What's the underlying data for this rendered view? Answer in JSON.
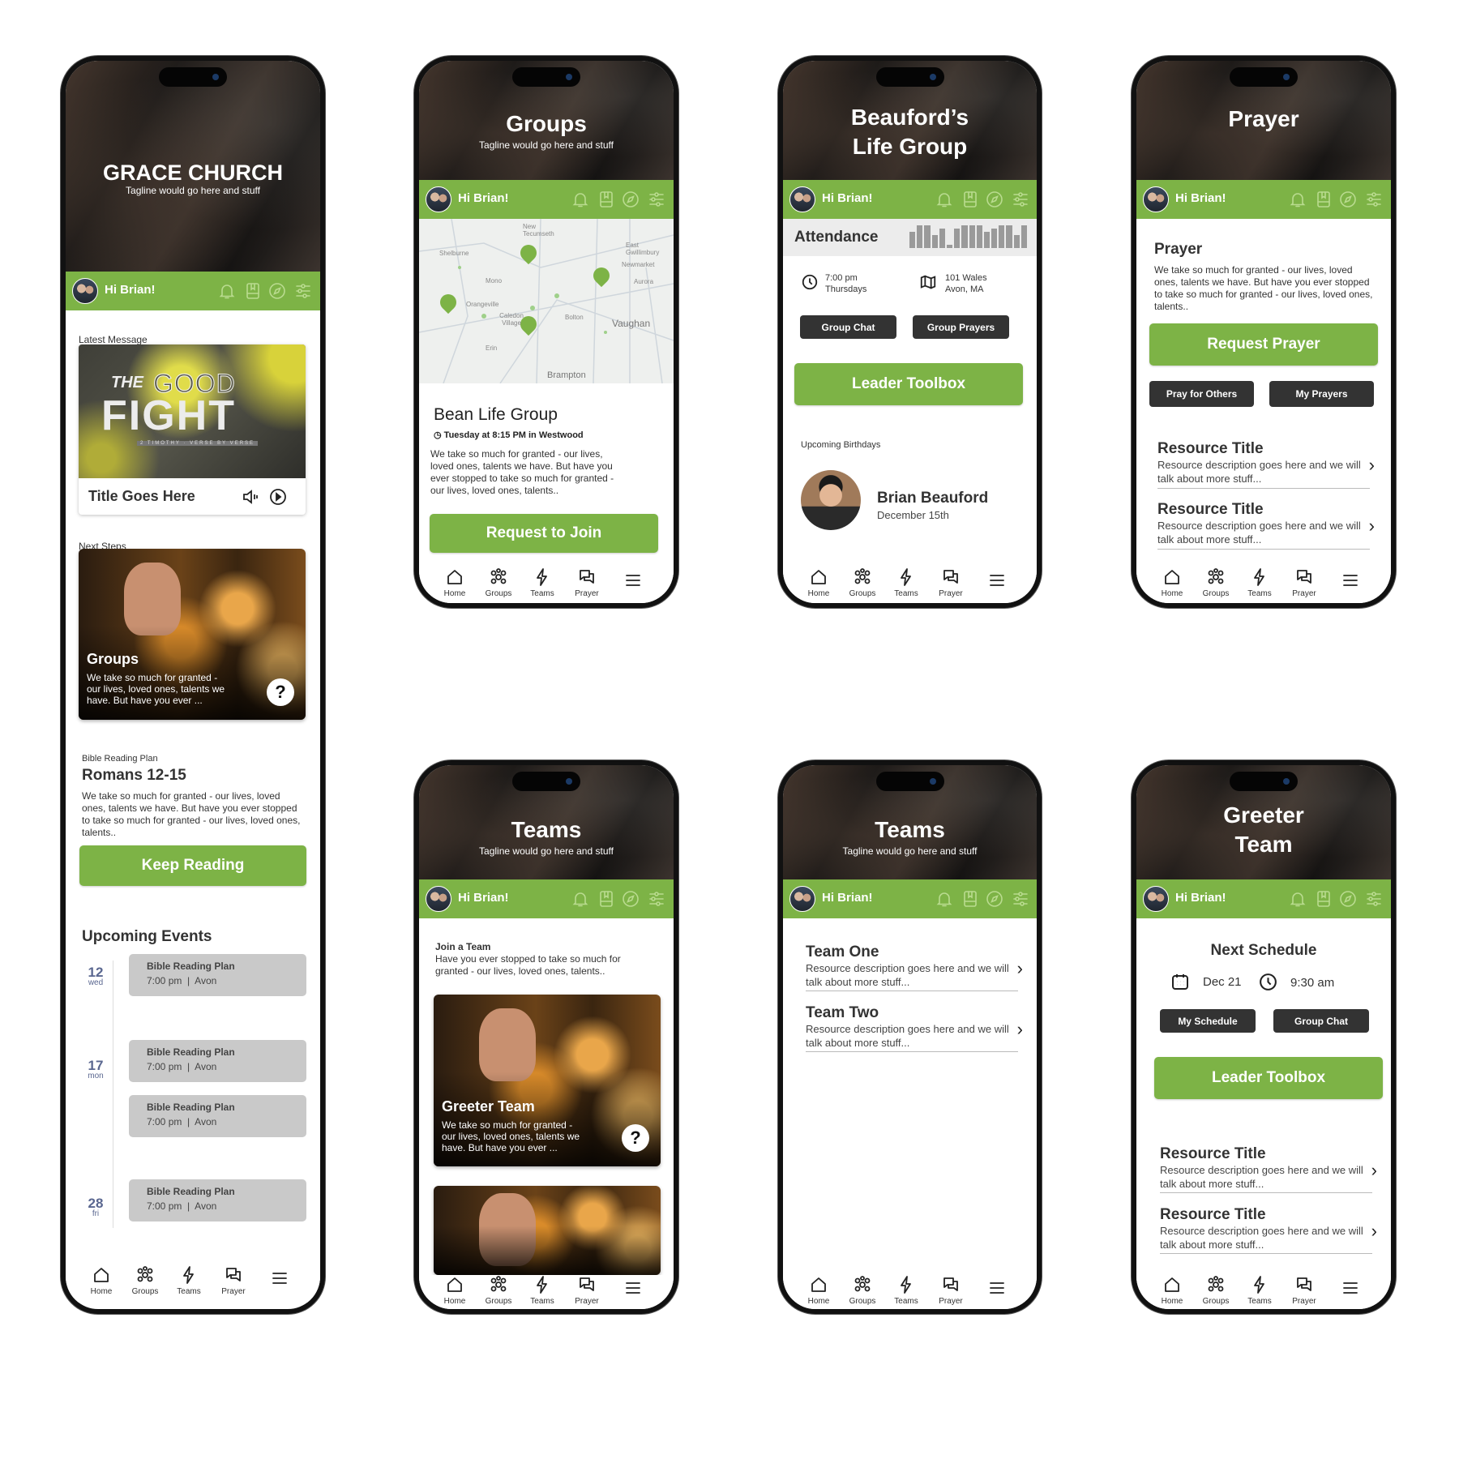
{
  "common": {
    "greeting": "Hi Brian!",
    "nav": [
      "Home",
      "Groups",
      "Teams",
      "Prayer"
    ],
    "icons": [
      "bell-icon",
      "book-icon",
      "compass-icon",
      "sliders-icon"
    ],
    "accent": "#7db346",
    "dark_button": "#333333"
  },
  "home": {
    "hero_title": "GRACE CHURCH",
    "tagline": "Tagline would go here and stuff",
    "latest_label": "Latest Message",
    "message": {
      "art_the": "THE",
      "art_good": "GOOD",
      "art_fight": "FIGHT",
      "art_sub": "2 TIMOTHY · VERSE BY VERSE",
      "title": "Title Goes Here"
    },
    "next_steps_label": "Next Steps",
    "next_card": {
      "title": "Groups",
      "text": "We take so much for granted - our lives, loved ones, talents we have. But have you ever ..."
    },
    "plan_label": "Bible Reading Plan",
    "plan_title": "Romans 12-15",
    "plan_text": "We take so much for granted - our lives, loved ones, talents we have. But have you ever stopped to take so much for granted - our lives, loved ones, talents..",
    "plan_button": "Keep Reading",
    "events_title": "Upcoming Events",
    "dates": [
      {
        "day": "12",
        "dow": "wed"
      },
      {
        "day": "17",
        "dow": "mon"
      },
      {
        "day": "28",
        "dow": "fri"
      }
    ],
    "events": [
      {
        "title": "Bible Reading Plan",
        "time": "7:00 pm",
        "place": "Avon"
      },
      {
        "title": "Bible Reading Plan",
        "time": "7:00 pm",
        "place": "Avon"
      },
      {
        "title": "Bible Reading Plan",
        "time": "7:00 pm",
        "place": "Avon"
      },
      {
        "title": "Bible Reading Plan",
        "time": "7:00 pm",
        "place": "Avon"
      }
    ]
  },
  "groups": {
    "hero_title": "Groups",
    "tagline": "Tagline would go here and stuff",
    "map_labels": [
      "New Tecumseth",
      "Shelburne",
      "Mono",
      "Orangeville",
      "Caledon Village",
      "Bolton",
      "Vaughan",
      "Erin",
      "Brampton",
      "East Gwillimbury",
      "Newmarket",
      "Aurora"
    ],
    "group_name": "Bean Life Group",
    "schedule": "Tuesday at 8:15 PM in Westwood",
    "description": "We take so much for granted - our lives, loved ones, talents we have. But have you ever stopped to take so much for granted - our lives, loved ones, talents..",
    "join_button": "Request to Join"
  },
  "life_group": {
    "hero_line1": "Beauford’s",
    "hero_line2": "Life Group",
    "attendance_label": "Attendance",
    "attendance_bars": [
      5,
      7,
      7,
      4,
      6,
      1,
      6,
      7,
      7,
      7,
      5,
      6,
      7,
      7,
      4,
      7
    ],
    "time": "7:00 pm",
    "day": "Thursdays",
    "address1": "101 Wales",
    "address2": "Avon, MA",
    "chat_button": "Group Chat",
    "prayers_button": "Group Prayers",
    "toolbox_button": "Leader Toolbox",
    "birthdays_label": "Upcoming Birthdays",
    "birthday_name": "Brian Beauford",
    "birthday_date": "December 15th"
  },
  "prayer": {
    "hero_title": "Prayer",
    "heading": "Prayer",
    "text": "We take so much for granted - our lives, loved ones, talents we have. But have you ever stopped to take so much for granted - our lives, loved ones, talents..",
    "request_button": "Request Prayer",
    "others_button": "Pray for Others",
    "mine_button": "My Prayers",
    "resources": [
      {
        "title": "Resource Title",
        "desc": "Resource description goes here and we will talk about more stuff..."
      },
      {
        "title": "Resource Title",
        "desc": "Resource description goes here and we will talk about more stuff..."
      }
    ]
  },
  "teams": {
    "hero_title": "Teams",
    "tagline": "Tagline would go here and stuff",
    "join_title": "Join a Team",
    "join_text": "Have you ever stopped to take so much for granted - our lives, loved ones, talents..",
    "card": {
      "title": "Greeter Team",
      "text": "We take so much for granted - our lives, loved ones, talents we have. But have you ever ..."
    }
  },
  "teams_list": {
    "hero_title": "Teams",
    "tagline": "Tagline would go here and stuff",
    "items": [
      {
        "title": "Team One",
        "desc": "Resource description goes here and we will talk about more stuff..."
      },
      {
        "title": "Team Two",
        "desc": "Resource description goes here and we will talk about more stuff..."
      }
    ]
  },
  "greeter": {
    "hero_line1": "Greeter",
    "hero_line2": "Team",
    "schedule_title": "Next Schedule",
    "date": "Dec 21",
    "time": "9:30 am",
    "schedule_button": "My Schedule",
    "chat_button": "Group Chat",
    "toolbox_button": "Leader Toolbox",
    "resources": [
      {
        "title": "Resource Title",
        "desc": "Resource description goes here and we will talk about more stuff..."
      },
      {
        "title": "Resource Title",
        "desc": "Resource description goes here and we will talk about more stuff..."
      }
    ]
  }
}
